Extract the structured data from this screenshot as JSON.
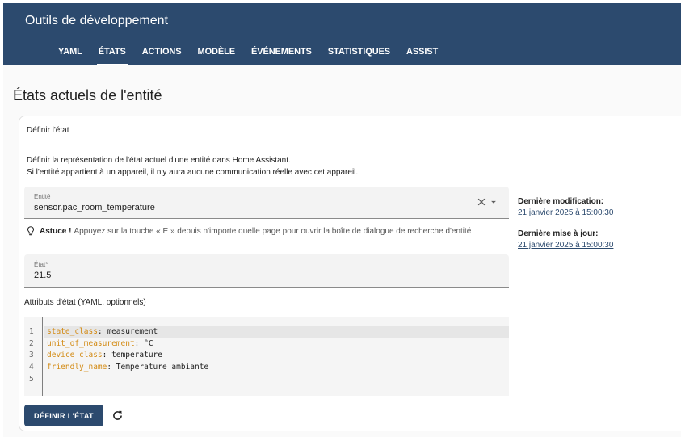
{
  "header": {
    "title": "Outils de développement",
    "tabs": [
      {
        "label": "YAML",
        "active": false
      },
      {
        "label": "ÉTATS",
        "active": true
      },
      {
        "label": "ACTIONS",
        "active": false
      },
      {
        "label": "MODÈLE",
        "active": false
      },
      {
        "label": "ÉVÉNEMENTS",
        "active": false
      },
      {
        "label": "STATISTIQUES",
        "active": false
      },
      {
        "label": "ASSIST",
        "active": false
      }
    ],
    "color": "#2c4a6e"
  },
  "main": {
    "heading": "États actuels de l'entité",
    "card": {
      "title": "Définir l'état",
      "description_line1": "Définir la représentation de l'état actuel d'une entité dans Home Assistant.",
      "description_line2": "Si l'entité appartient à un appareil, il n'y aura aucune communication réelle avec cet appareil.",
      "entity_field": {
        "label": "Entité",
        "value": "sensor.pac_room_temperature",
        "clear_icon": "close-icon",
        "dropdown_icon": "chevron-down-icon"
      },
      "tip": {
        "icon": "lightbulb-icon",
        "title": "Astuce !",
        "text": "Appuyez sur la touche « E » depuis n'importe quelle page pour ouvrir la boîte de dialogue de recherche d'entité"
      },
      "state_field": {
        "label": "État*",
        "value": "21.5"
      },
      "attributes_label": "Attributs d'état (YAML, optionnels)",
      "yaml_lines": [
        {
          "num": "1",
          "key": "state_class",
          "value": ": measurement"
        },
        {
          "num": "2",
          "key": "unit_of_measurement",
          "value": ": °C"
        },
        {
          "num": "3",
          "key": "device_class",
          "value": ": temperature"
        },
        {
          "num": "4",
          "key": "friendly_name",
          "value": ": Temperature ambiante"
        },
        {
          "num": "5",
          "key": "",
          "value": ""
        }
      ],
      "last_changed_label": "Dernière modification:",
      "last_changed_value": "21 janvier 2025 à 15:00:30",
      "last_updated_label": "Dernière mise à jour:",
      "last_updated_value": "21 janvier 2025 à 15:00:30",
      "set_state_button": "DÉFINIR L'ÉTAT",
      "refresh_icon": "refresh-icon",
      "yaml_key_color": "#d38b15"
    }
  }
}
